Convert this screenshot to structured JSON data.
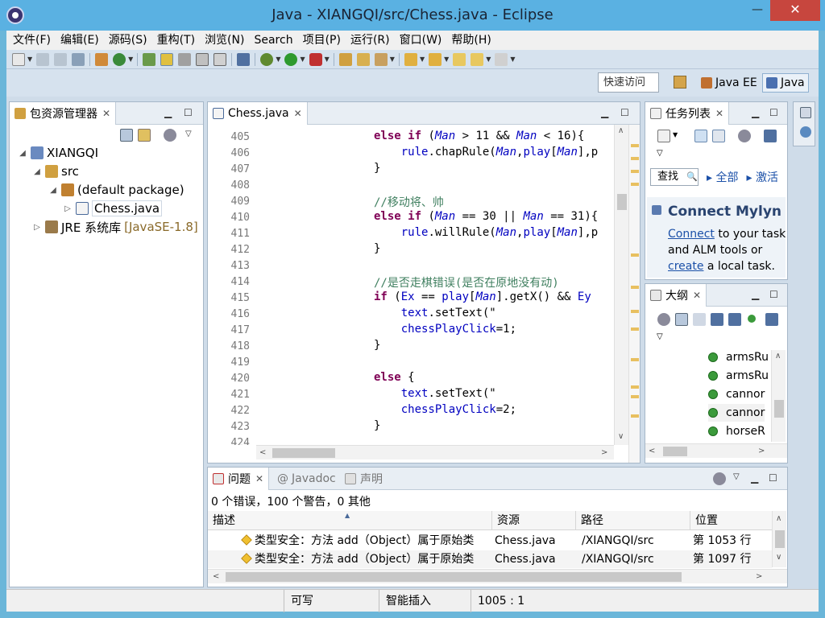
{
  "window": {
    "title": "Java - XIANGQI/src/Chess.java - Eclipse",
    "minimize": "—",
    "maximize": "☐",
    "close": "✕"
  },
  "menu": [
    "文件(F)",
    "编辑(E)",
    "源码(S)",
    "重构(T)",
    "浏览(N)",
    "Search",
    "项目(P)",
    "运行(R)",
    "窗口(W)",
    "帮助(H)"
  ],
  "toolbar": {
    "quick_access": "快速访问",
    "perspectives": [
      "Java EE",
      "Java"
    ]
  },
  "package_explorer": {
    "title": "包资源管理器",
    "tree": [
      {
        "label": "XIANGQI",
        "indent": 0,
        "expanded": true
      },
      {
        "label": "src",
        "indent": 1,
        "expanded": true
      },
      {
        "label": "(default package)",
        "indent": 2,
        "expanded": true
      },
      {
        "label": "Chess.java",
        "indent": 3,
        "expanded": false
      },
      {
        "label": "JRE 系统库",
        "suffix": "[JavaSE-1.8]",
        "indent": 1,
        "expanded": false
      }
    ]
  },
  "editor": {
    "tab": "Chess.java",
    "lines": [
      {
        "n": "405",
        "html": "<span class=\"kw\">else if</span> (<span class=\"var\">Man</span> &gt; 11 &amp;&amp; <span class=\"var\">Man</span> &lt; 16){"
      },
      {
        "n": "406",
        "html": "    <span class=\"fld\">rule</span>.chapRule(<span class=\"var\">Man</span>,<span class=\"fld\">play</span>[<span class=\"var\">Man</span>],p"
      },
      {
        "n": "407",
        "html": "}"
      },
      {
        "n": "408",
        "html": ""
      },
      {
        "n": "409",
        "html": "<span class=\"cm\">//移动将、帅</span>"
      },
      {
        "n": "410",
        "html": "<span class=\"kw\">else if</span> (<span class=\"var\">Man</span> == 30 || <span class=\"var\">Man</span> == 31){"
      },
      {
        "n": "411",
        "html": "    <span class=\"fld\">rule</span>.willRule(<span class=\"var\">Man</span>,<span class=\"fld\">play</span>[<span class=\"var\">Man</span>],p"
      },
      {
        "n": "412",
        "html": "}"
      },
      {
        "n": "413",
        "html": ""
      },
      {
        "n": "414",
        "html": "<span class=\"cm\">//是否走棋错误(是否在原地没有动)</span>"
      },
      {
        "n": "415",
        "html": "<span class=\"kw\">if</span> (<span class=\"fld\">Ex</span> == <span class=\"fld\">play</span>[<span class=\"var\">Man</span>].getX() &amp;&amp; <span class=\"fld\">Ey</span>"
      },
      {
        "n": "416",
        "html": "    <span class=\"fld\">text</span>.setText(\""
      },
      {
        "n": "417",
        "html": "    <span class=\"fld\">chessPlayClick</span>=1;"
      },
      {
        "n": "418",
        "html": "}"
      },
      {
        "n": "419",
        "html": ""
      },
      {
        "n": "420",
        "html": "<span class=\"kw\">else</span> {"
      },
      {
        "n": "421",
        "html": "    <span class=\"fld\">text</span>.setText(\""
      },
      {
        "n": "422",
        "html": "    <span class=\"fld\">chessPlayClick</span>=2;"
      },
      {
        "n": "423",
        "html": "}"
      },
      {
        "n": "424",
        "html": ""
      }
    ]
  },
  "task_list": {
    "title": "任务列表",
    "search_label": "查找",
    "filter_all": "全部",
    "filter_active": "激活",
    "mylyn_title": "Connect Mylyn",
    "mylyn_connect": "Connect",
    "mylyn_text1": " to your task",
    "mylyn_text2": "and ALM tools or",
    "mylyn_create": "create",
    "mylyn_text3": " a local task."
  },
  "outline": {
    "title": "大纲",
    "items": [
      "armsRu",
      "armsRu",
      "cannor",
      "cannor",
      "horseR"
    ]
  },
  "problems": {
    "tab": "问题",
    "tab_javadoc": "Javadoc",
    "tab_decl": "声明",
    "summary": "0 个错误，100 个警告，0 其他",
    "columns": [
      "描述",
      "资源",
      "路径",
      "位置"
    ],
    "rows": [
      {
        "desc": "类型安全：方法 add（Object）属于原始类",
        "resource": "Chess.java",
        "path": "/XIANGQI/src",
        "location": "第 1053 行"
      },
      {
        "desc": "类型安全：方法 add（Object）属于原始类",
        "resource": "Chess.java",
        "path": "/XIANGQI/src",
        "location": "第 1097 行"
      }
    ]
  },
  "status": {
    "writable": "可写",
    "insert_mode": "智能插入",
    "position": "1005 : 1"
  }
}
